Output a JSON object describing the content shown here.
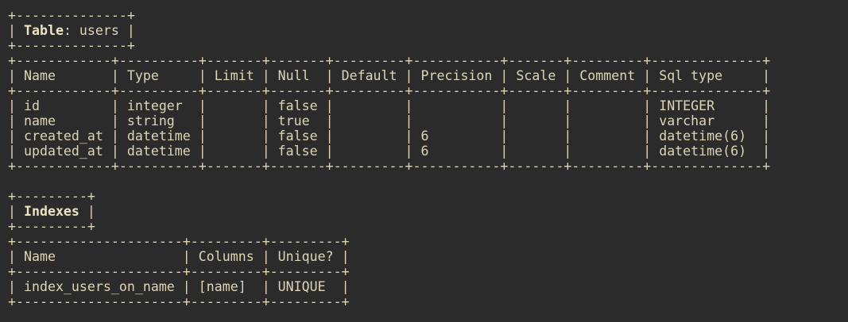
{
  "table_section": {
    "title_border": "+--------------+",
    "title_prefix": "| ",
    "title_label": "Table",
    "title_suffix": ": users |",
    "border": "+------------+----------+-------+-------+---------+-----------+-------+---------+--------------+",
    "header": "| Name       | Type     | Limit | Null  | Default | Precision | Scale | Comment | Sql type     |",
    "rows": [
      "| id         | integer  |       | false |         |           |       |         | INTEGER      |",
      "| name       | string   |       | true  |         |           |       |         | varchar      |",
      "| created_at | datetime |       | false |         | 6         |       |         | datetime(6)  |",
      "| updated_at | datetime |       | false |         | 6         |       |         | datetime(6)  |"
    ]
  },
  "indexes_section": {
    "title_border": "+---------+",
    "title_prefix": "| ",
    "title_label": "Indexes",
    "title_suffix": " |",
    "border": "+---------------------+---------+---------+",
    "header": "| Name                | Columns | Unique? |",
    "rows": [
      "| index_users_on_name | [name]  | UNIQUE  |"
    ]
  }
}
